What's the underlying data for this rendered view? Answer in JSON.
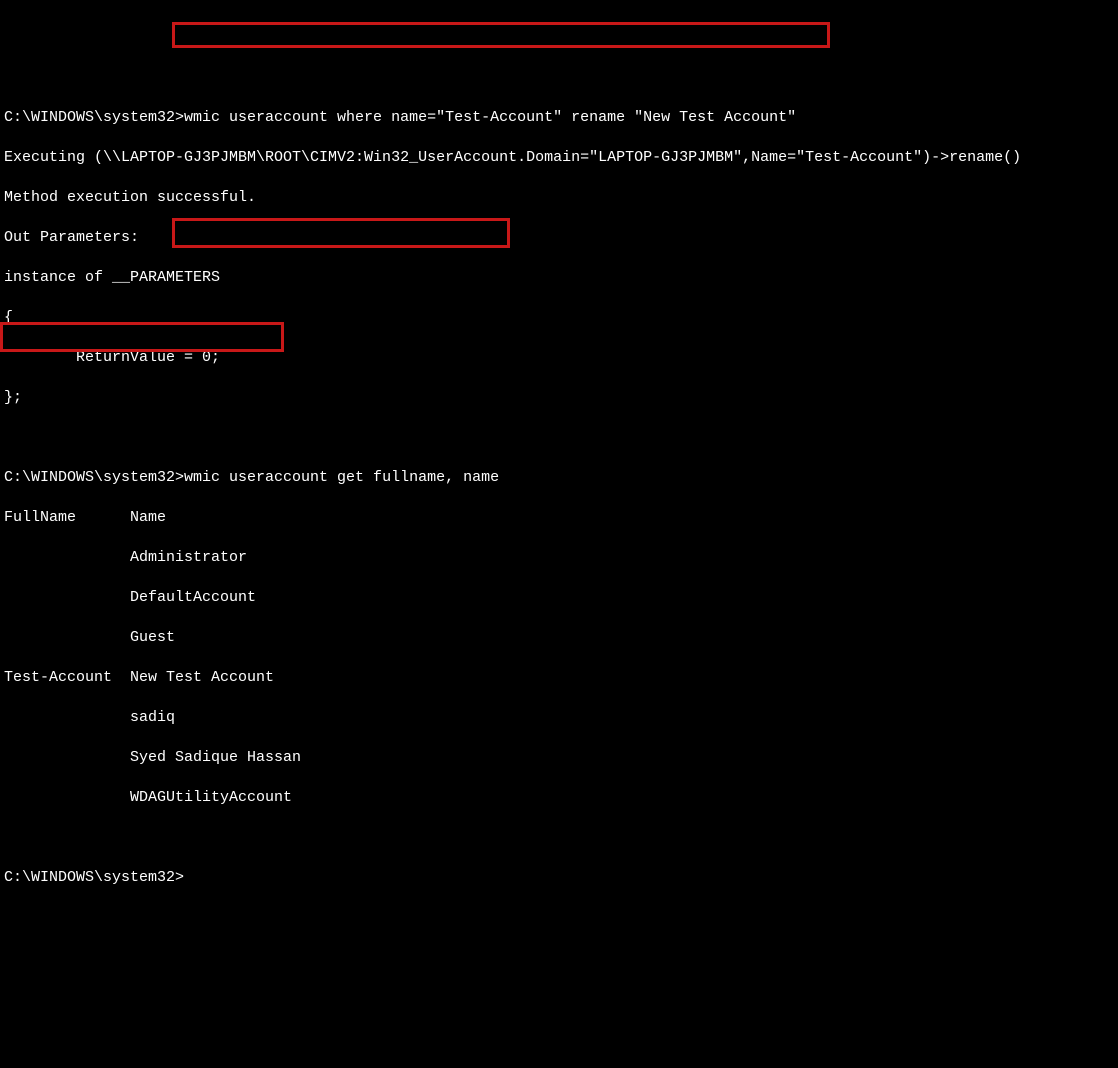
{
  "prompt1": "C:\\WINDOWS\\system32>",
  "cmd1": "wmic useraccount where name=\"Test-Account\" rename \"New Test Account\"",
  "out1_l1": "Executing (\\\\LAPTOP-GJ3PJMBM\\ROOT\\CIMV2:Win32_UserAccount.Domain=\"LAPTOP-GJ3PJMBM\",Name=\"Test-Account\")->rename()",
  "out1_l2": "Method execution successful.",
  "out1_l3": "Out Parameters:",
  "out1_l4": "instance of __PARAMETERS",
  "out1_l5": "{",
  "out1_l6": "        ReturnValue = 0;",
  "out1_l7": "};",
  "blank": "",
  "prompt2": "C:\\WINDOWS\\system32>",
  "cmd2": "wmic useraccount get fullname, name",
  "hdr": "FullName      Name",
  "r1": "              Administrator",
  "r2": "              DefaultAccount",
  "r3": "              Guest",
  "r4": "Test-Account  New Test Account",
  "r5": "              sadiq",
  "r6": "              Syed Sadique Hassan",
  "r7": "              WDAGUtilityAccount",
  "prompt3": "C:\\WINDOWS\\system32>"
}
